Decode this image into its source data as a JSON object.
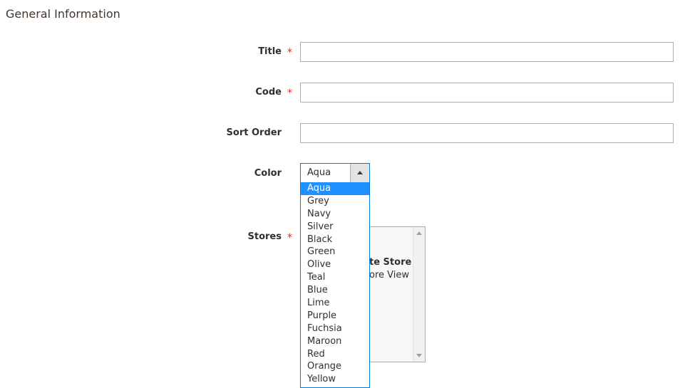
{
  "section": {
    "title": "General Information"
  },
  "fields": {
    "title": {
      "label": "Title",
      "required_mark": "*",
      "value": ""
    },
    "code": {
      "label": "Code",
      "required_mark": "*",
      "value": ""
    },
    "sort_order": {
      "label": "Sort Order",
      "value": ""
    },
    "color": {
      "label": "Color",
      "selected": "Aqua",
      "options": [
        "Aqua",
        "Grey",
        "Navy",
        "Silver",
        "Black",
        "Green",
        "Olive",
        "Teal",
        "Blue",
        "Lime",
        "Purple",
        "Fuchsia",
        "Maroon",
        "Red",
        "Orange",
        "Yellow"
      ]
    },
    "stores": {
      "label": "Stores",
      "required_mark": "*",
      "visible_text": [
        "te Store",
        "ore View"
      ]
    }
  },
  "colors": {
    "accent": "#007bdb",
    "highlight": "#1e90ff",
    "required": "#e22626"
  }
}
